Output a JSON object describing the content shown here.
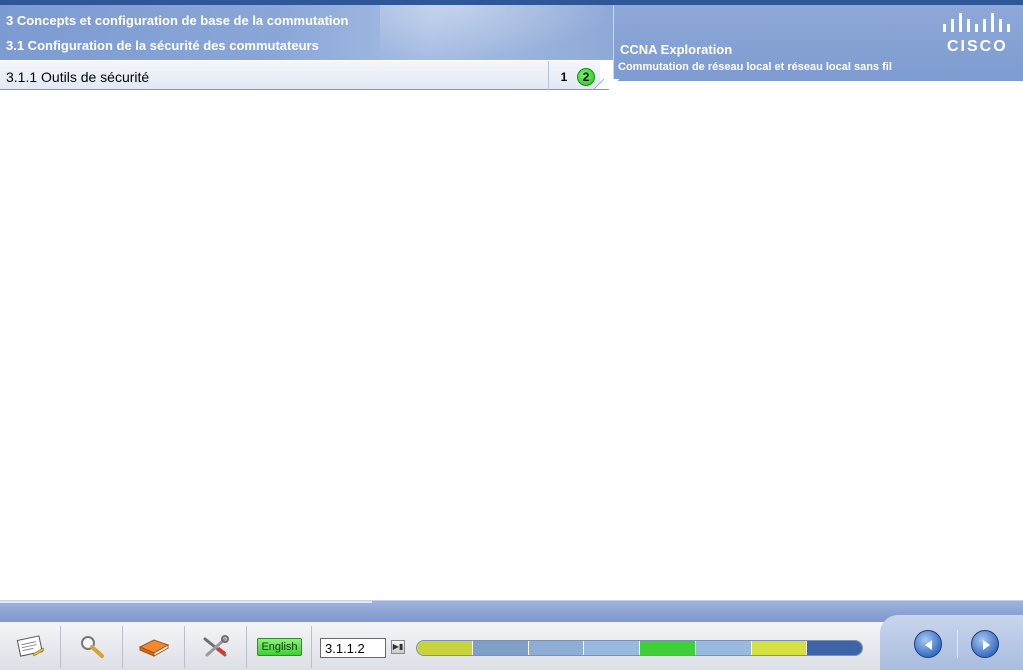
{
  "header": {
    "chapter_title": "3 Concepts et configuration de base de la commutation",
    "section_title": "3.1 Configuration de la sécurité des commutateurs",
    "course_title": "CCNA Exploration",
    "course_subtitle": "Commutation de réseau local et réseau local sans fil",
    "logo_text": "CISCO",
    "logo_icon": "cisco-bridge-icon"
  },
  "topic": {
    "title": "3.1.1 Outils de sécurité",
    "pages": [
      "1",
      "2"
    ],
    "current_page": "2"
  },
  "toolbar": {
    "tools": [
      {
        "name": "notes",
        "icon": "notepad-icon"
      },
      {
        "name": "search",
        "icon": "magnifier-icon"
      },
      {
        "name": "glossary",
        "icon": "book-icon"
      },
      {
        "name": "tools",
        "icon": "tools-icon"
      }
    ],
    "language_label": "English",
    "page_input_value": "3.1.1.2",
    "go_icon": "go-to-page-icon",
    "back_icon": "back-arrow-icon",
    "next_icon": "next-arrow-icon"
  },
  "progress": {
    "segments": [
      {
        "color": "#c8d43c"
      },
      {
        "color": "#7f9fc9"
      },
      {
        "color": "#8eaed6"
      },
      {
        "color": "#9ab9de"
      },
      {
        "color": "#3fcf36"
      },
      {
        "color": "#9ab9de"
      },
      {
        "color": "#d3e03f"
      },
      {
        "color": "#3d64a6"
      }
    ]
  }
}
